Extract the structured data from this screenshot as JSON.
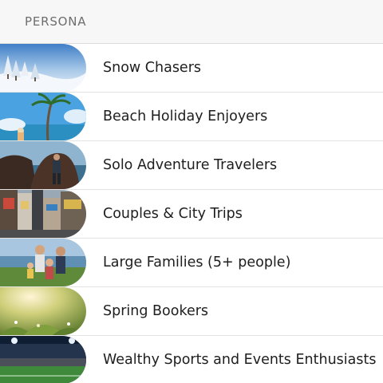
{
  "header": {
    "title": "PERSONA"
  },
  "personas": [
    {
      "label": "Snow Chasers",
      "image": "snowy-forest-photo"
    },
    {
      "label": "Beach Holiday Enjoyers",
      "image": "palm-beach-photo"
    },
    {
      "label": "Solo Adventure Travelers",
      "image": "hiker-rocks-photo"
    },
    {
      "label": "Couples & City Trips",
      "image": "city-street-photo"
    },
    {
      "label": "Large Families (5+ people)",
      "image": "family-photo"
    },
    {
      "label": "Spring Bookers",
      "image": "spring-meadow-photo"
    },
    {
      "label": "Wealthy Sports and Events Enthusiasts",
      "image": "stadium-photo"
    }
  ]
}
